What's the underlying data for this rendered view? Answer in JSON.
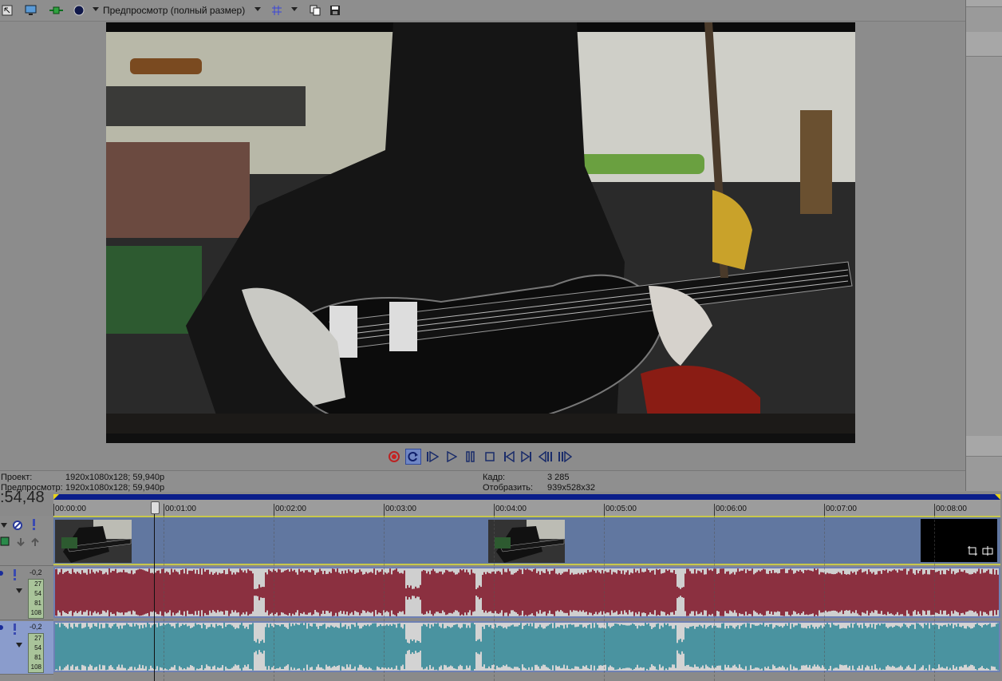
{
  "toolbar": {
    "preview_mode_label": "Предпросмотр (полный размер)",
    "icons": [
      "properties-icon",
      "monitor-icon",
      "split-screen-icon",
      "overlay-icon",
      "grid-icon",
      "copy-snapshot-icon",
      "save-snapshot-icon"
    ]
  },
  "transport": {
    "buttons": [
      "record",
      "loop",
      "play-from-start",
      "play",
      "pause",
      "stop",
      "prev-frame-start",
      "next-frame-end",
      "prev-frame",
      "next-frame"
    ]
  },
  "info": {
    "project_label": "Проект:",
    "project_value": "1920x1080x128; 59,940p",
    "preview_label": "Предпросмотр:",
    "preview_value": "1920x1080x128; 59,940p",
    "frame_label": "Кадр:",
    "frame_value": "3 285",
    "display_label": "Отобразить:",
    "display_value": "939x528x32"
  },
  "timeline": {
    "time_display": ":54,48",
    "ruler_labels": [
      "00:00:00",
      "00:01:00",
      "00:02:00",
      "00:03:00",
      "00:04:00",
      "00:05:00",
      "00:06:00",
      "00:07:00",
      "00:08:00"
    ],
    "tracks": [
      {
        "type": "audio",
        "level": "-0,2",
        "meter": [
          "27",
          "54",
          "81",
          "108"
        ]
      },
      {
        "type": "audio",
        "level": "-0,2",
        "meter": [
          "27",
          "54",
          "81",
          "108"
        ]
      }
    ]
  },
  "colors": {
    "audio1_wave": "#8b3040",
    "audio2_wave": "#4a93a0",
    "video_track": "#6177a0",
    "ruler_bar": "#0a1e8a"
  }
}
